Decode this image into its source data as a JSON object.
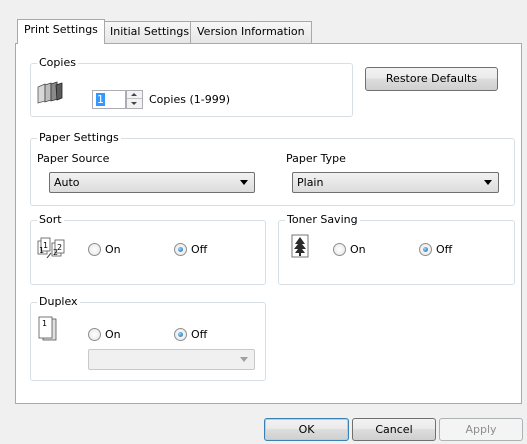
{
  "tabs": [
    "Print Settings",
    "Initial Settings",
    "Version Information"
  ],
  "copies": {
    "legend": "Copies",
    "value": "1",
    "range_label": "Copies (1-999)",
    "icon": "copies-stack-icon"
  },
  "restore_defaults_label": "Restore Defaults",
  "paper": {
    "legend": "Paper Settings",
    "source_label": "Paper Source",
    "source_value": "Auto",
    "type_label": "Paper Type",
    "type_value": "Plain"
  },
  "sort": {
    "legend": "Sort",
    "on_label": "On",
    "off_label": "Off",
    "selected": "Off",
    "icon": "collate-icon"
  },
  "toner": {
    "legend": "Toner Saving",
    "on_label": "On",
    "off_label": "Off",
    "selected": "Off",
    "icon": "toner-tree-icon"
  },
  "duplex": {
    "legend": "Duplex",
    "on_label": "On",
    "off_label": "Off",
    "selected": "Off",
    "binding_value": "",
    "icon": "duplex-page-icon"
  },
  "footer": {
    "ok_label": "OK",
    "cancel_label": "Cancel",
    "apply_label": "Apply"
  },
  "colors": {
    "panel_bg": "#ffffff",
    "dialog_bg": "#f0f0f0",
    "group_border": "#d5dfe5",
    "radio_accent": "#1a5f9e"
  }
}
